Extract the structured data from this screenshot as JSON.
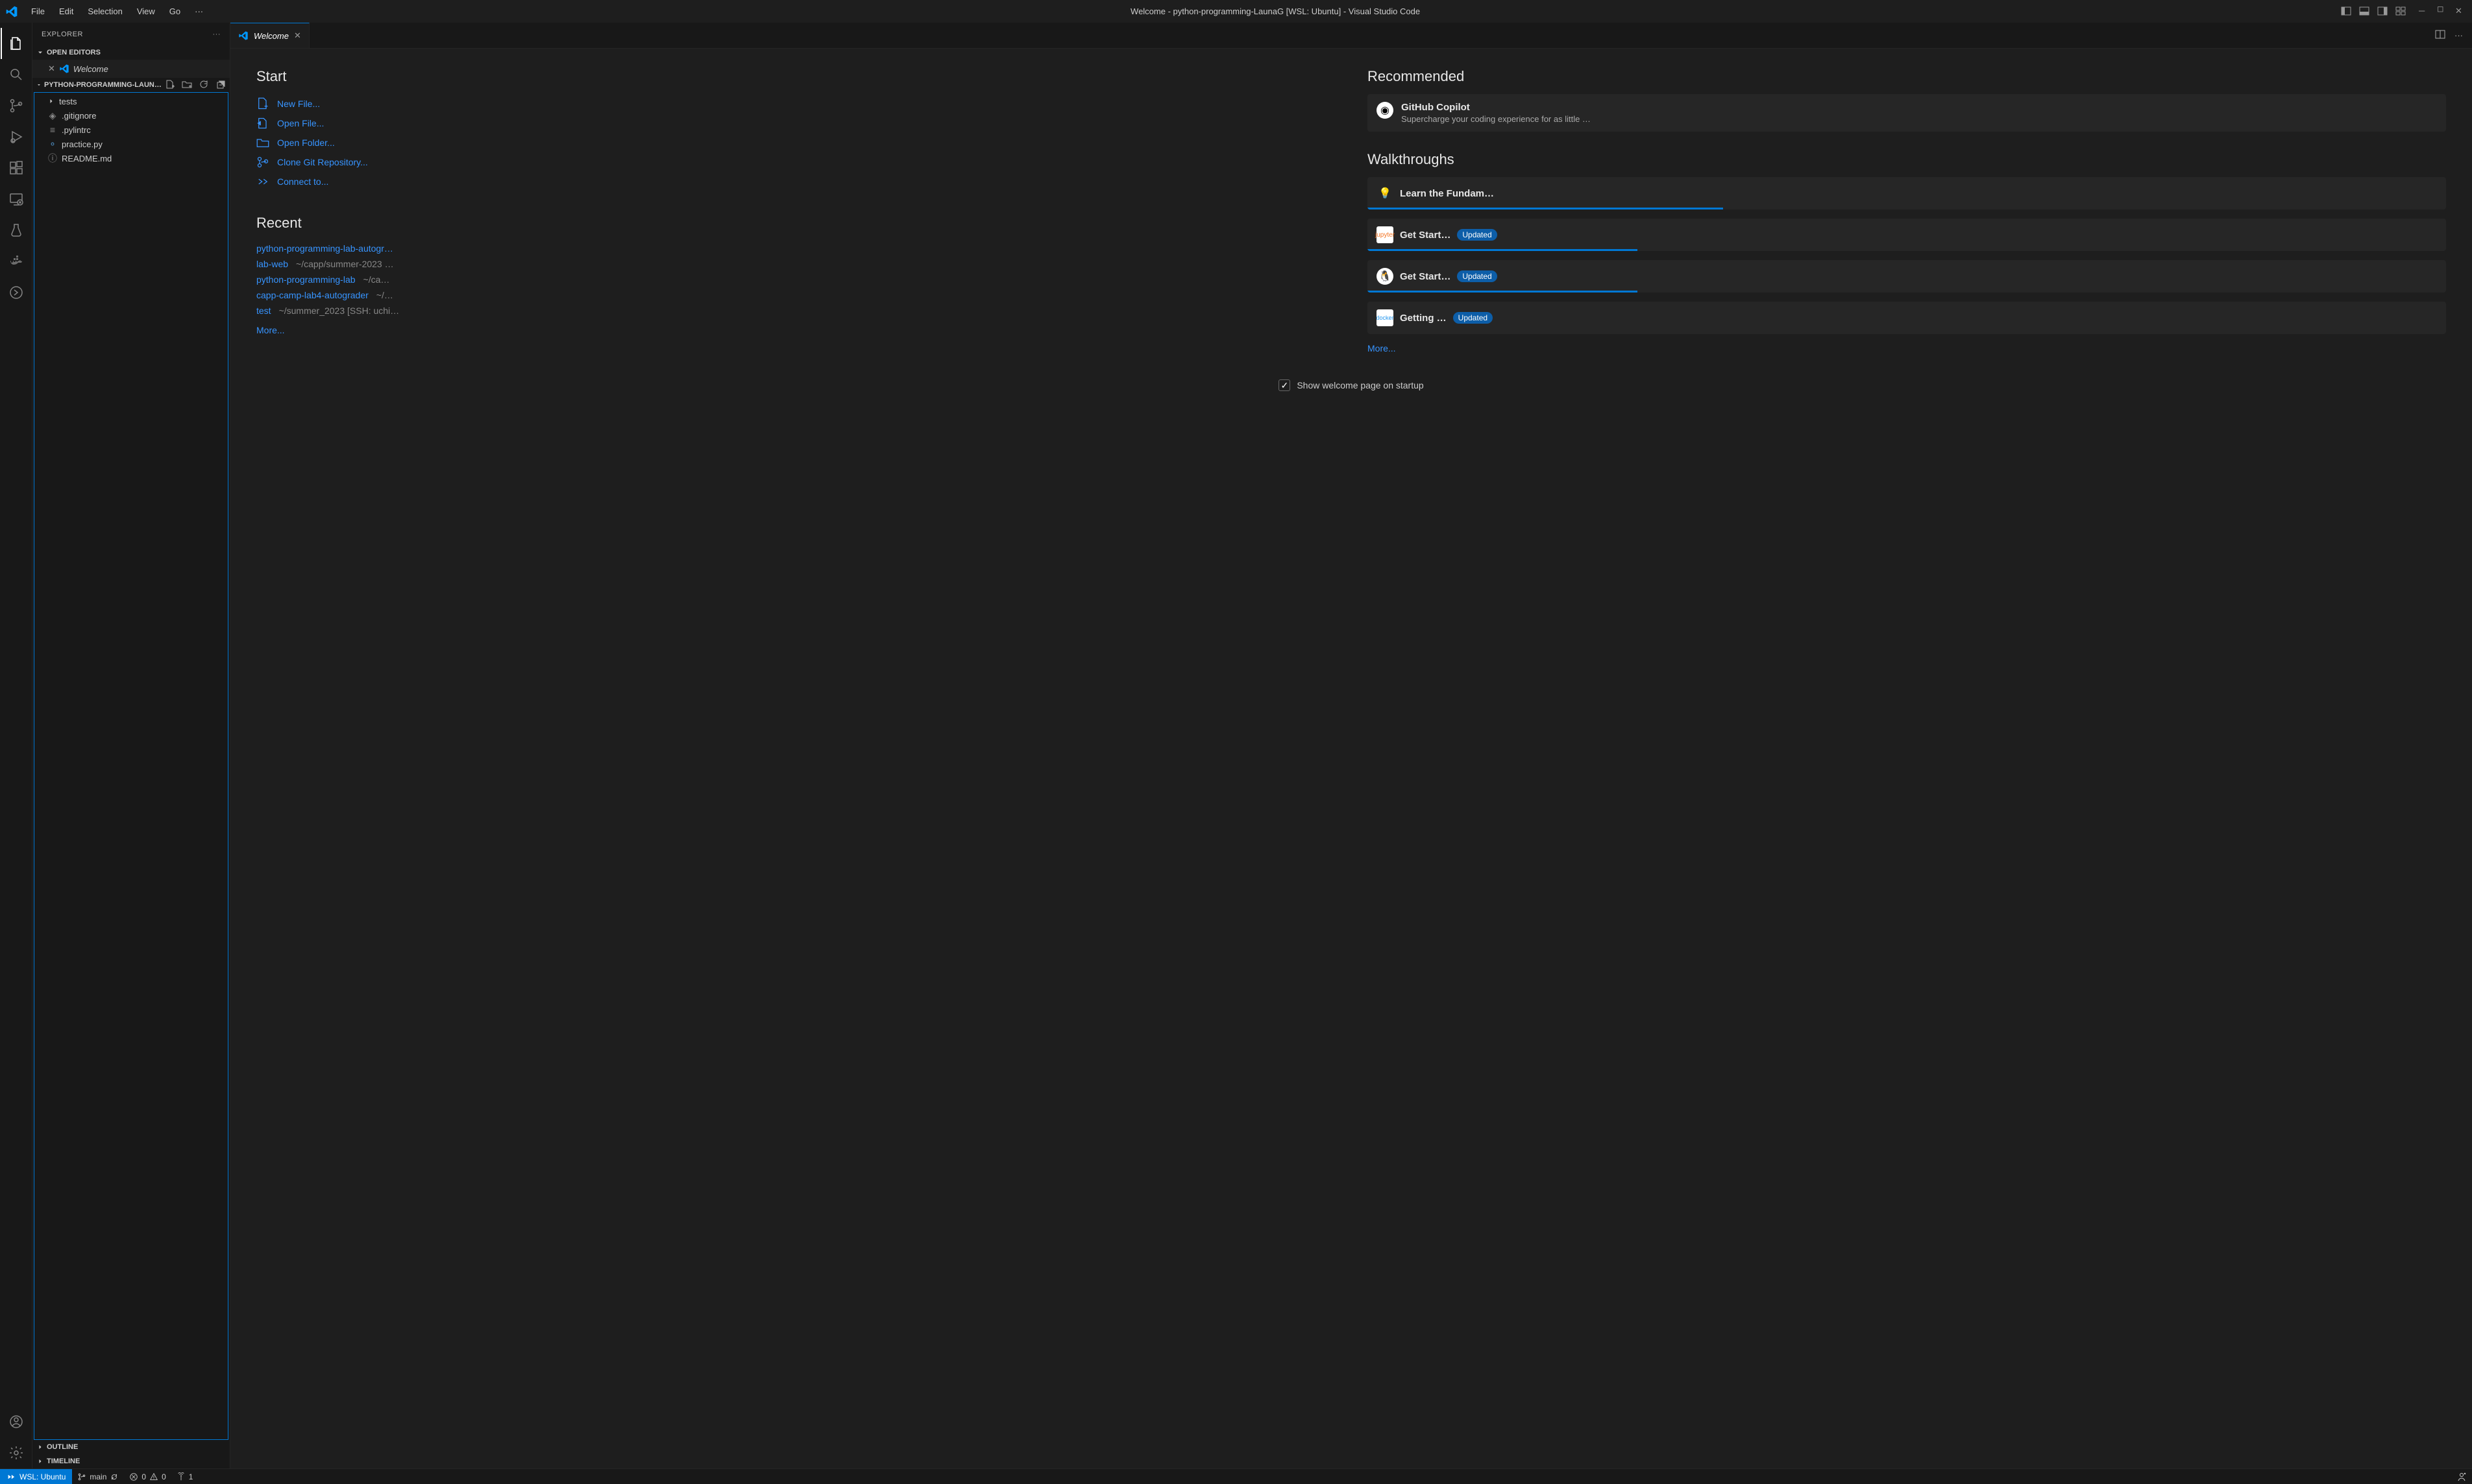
{
  "title_bar": {
    "menu": [
      "File",
      "Edit",
      "Selection",
      "View",
      "Go"
    ],
    "window_title": "Welcome - python-programming-LaunaG [WSL: Ubuntu] - Visual Studio Code"
  },
  "activity_bar": [
    {
      "name": "explorer",
      "active": true
    },
    {
      "name": "search"
    },
    {
      "name": "source-control"
    },
    {
      "name": "run-debug"
    },
    {
      "name": "extensions"
    },
    {
      "name": "remote-explorer"
    },
    {
      "name": "testing"
    },
    {
      "name": "docker"
    },
    {
      "name": "live-share"
    }
  ],
  "sidebar": {
    "title": "EXPLORER",
    "open_editors": {
      "label": "OPEN EDITORS",
      "items": [
        "Welcome"
      ]
    },
    "workspace": {
      "label": "PYTHON-PROGRAMMING-LAUNAG [WSL: UBUNTU]"
    },
    "tree": [
      {
        "name": "tests",
        "type": "folder"
      },
      {
        "name": ".gitignore",
        "type": "file"
      },
      {
        "name": ".pylintrc",
        "type": "file"
      },
      {
        "name": "practice.py",
        "type": "python"
      },
      {
        "name": "README.md",
        "type": "readme"
      }
    ],
    "outline": "OUTLINE",
    "timeline": "TIMELINE"
  },
  "tabs": {
    "active": "Welcome"
  },
  "welcome": {
    "start": {
      "heading": "Start",
      "items": [
        {
          "label": "New File...",
          "icon": "new-file"
        },
        {
          "label": "Open File...",
          "icon": "open-file"
        },
        {
          "label": "Open Folder...",
          "icon": "folder"
        },
        {
          "label": "Clone Git Repository...",
          "icon": "git"
        },
        {
          "label": "Connect to...",
          "icon": "remote"
        }
      ]
    },
    "recent": {
      "heading": "Recent",
      "items": [
        {
          "name": "python-programming-lab-autogr…",
          "path": ""
        },
        {
          "name": "lab-web",
          "path": "~/capp/summer-2023 …"
        },
        {
          "name": "python-programming-lab",
          "path": "~/ca…"
        },
        {
          "name": "capp-camp-lab4-autograder",
          "path": "~/…"
        },
        {
          "name": "test",
          "path": "~/summer_2023 [SSH: uchi…"
        }
      ],
      "more": "More..."
    },
    "recommended": {
      "heading": "Recommended",
      "card": {
        "title": "GitHub Copilot",
        "desc": "Supercharge your coding experience for as little …"
      }
    },
    "walkthroughs": {
      "heading": "Walkthroughs",
      "cards": [
        {
          "title": "Learn the Fundam…",
          "icon": "bulb",
          "updated": false,
          "progress": 33
        },
        {
          "title": "Get Start…",
          "icon": "jupyter",
          "updated": true,
          "progress": 25
        },
        {
          "title": "Get Start…",
          "icon": "linux",
          "updated": true,
          "progress": 25
        },
        {
          "title": "Getting …",
          "icon": "docker",
          "updated": true,
          "progress": 0
        }
      ],
      "more": "More...",
      "updated_label": "Updated"
    },
    "show_on_startup": "Show welcome page on startup",
    "show_on_startup_checked": true
  },
  "status_bar": {
    "remote": "WSL: Ubuntu",
    "branch": "main",
    "errors": "0",
    "warnings": "0",
    "ports": "1"
  }
}
